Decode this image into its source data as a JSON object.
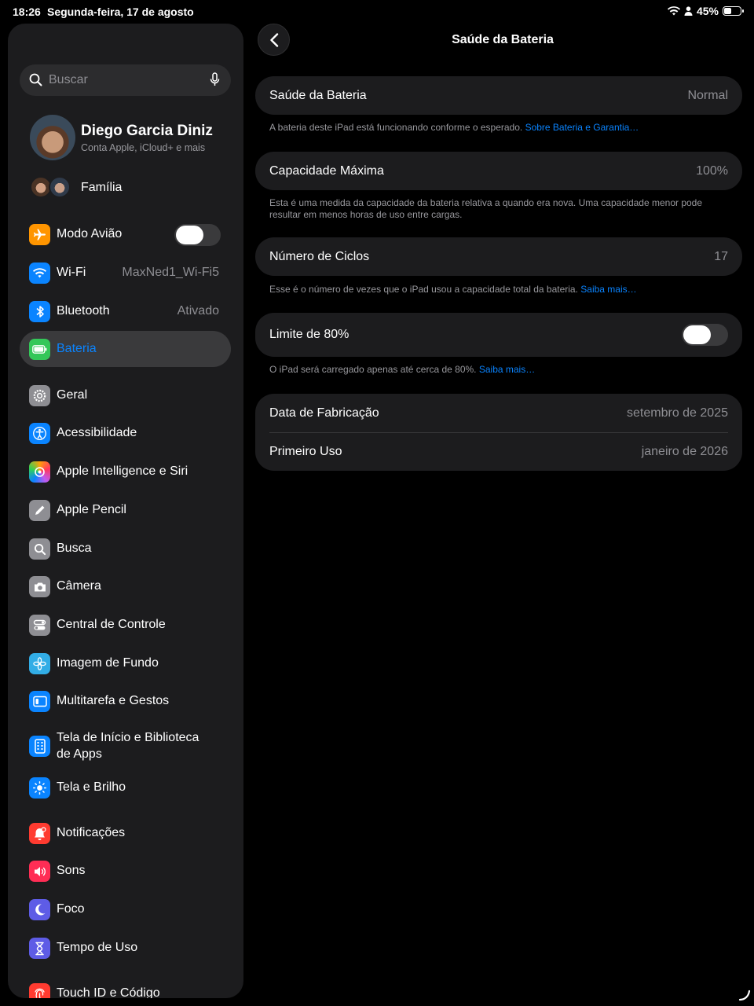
{
  "status_bar": {
    "time": "18:26",
    "date": "Segunda-feira, 17 de agosto",
    "battery_percent": "45%",
    "battery_level": 0.45
  },
  "sidebar": {
    "search_placeholder": "Buscar",
    "profile": {
      "name": "Diego Garcia Diniz",
      "subtitle": "Conta Apple, iCloud+ e mais"
    },
    "family_label": "Família",
    "items": [
      {
        "label": "Modo Avião",
        "icon": "airplane-icon",
        "color": "#ff9500",
        "toggle": false
      },
      {
        "label": "Wi-Fi",
        "icon": "wifi-icon",
        "color": "#0a84ff",
        "value": "MaxNed1_Wi-Fi5"
      },
      {
        "label": "Bluetooth",
        "icon": "bluetooth-icon",
        "color": "#0a84ff",
        "value": "Ativado"
      },
      {
        "label": "Bateria",
        "icon": "battery-icon",
        "color": "#34c759",
        "selected": true
      },
      {
        "label": "Geral",
        "icon": "gear-icon",
        "color": "#8e8e93"
      },
      {
        "label": "Acessibilidade",
        "icon": "accessibility-icon",
        "color": "#0a84ff"
      },
      {
        "label": "Apple Intelligence e Siri",
        "icon": "apple-intelligence-icon",
        "color": "#ff6b9d"
      },
      {
        "label": "Apple Pencil",
        "icon": "pencil-icon",
        "color": "#8e8e93"
      },
      {
        "label": "Busca",
        "icon": "search-icon",
        "color": "#8e8e93"
      },
      {
        "label": "Câmera",
        "icon": "camera-icon",
        "color": "#8e8e93"
      },
      {
        "label": "Central de Controle",
        "icon": "control-center-icon",
        "color": "#8e8e93"
      },
      {
        "label": "Imagem de Fundo",
        "icon": "wallpaper-icon",
        "color": "#32ade6"
      },
      {
        "label": "Multitarefa e Gestos",
        "icon": "multitasking-icon",
        "color": "#0a84ff"
      },
      {
        "label": "Tela de Início e Biblioteca de Apps",
        "icon": "home-screen-icon",
        "color": "#0a84ff"
      },
      {
        "label": "Tela e Brilho",
        "icon": "brightness-icon",
        "color": "#0a84ff"
      },
      {
        "label": "Notificações",
        "icon": "notifications-icon",
        "color": "#ff3b30"
      },
      {
        "label": "Sons",
        "icon": "sounds-icon",
        "color": "#ff2d55"
      },
      {
        "label": "Foco",
        "icon": "focus-moon-icon",
        "color": "#5e5ce6"
      },
      {
        "label": "Tempo de Uso",
        "icon": "hourglass-icon",
        "color": "#5e5ce6"
      },
      {
        "label": "Touch ID e Código",
        "icon": "fingerprint-icon",
        "color": "#ff3b30"
      }
    ]
  },
  "detail": {
    "title": "Saúde da Bateria",
    "battery_health": {
      "label": "Saúde da Bateria",
      "value": "Normal",
      "footnote": "A bateria deste iPad está funcionando conforme o esperado.",
      "link": "Sobre Bateria e Garantia…"
    },
    "max_capacity": {
      "label": "Capacidade Máxima",
      "value": "100%",
      "footnote": "Esta é uma medida da capacidade da bateria relativa a quando era nova. Uma capacidade menor pode resultar em menos horas de uso entre cargas."
    },
    "cycle_count": {
      "label": "Número de Ciclos",
      "value": "17",
      "footnote": "Esse é o número de vezes que o iPad usou a capacidade total da bateria.",
      "link": "Saiba mais…"
    },
    "limit_80": {
      "label": "Limite de 80%",
      "toggle": false,
      "footnote": "O iPad será carregado apenas até cerca de 80%.",
      "link": "Saiba mais…"
    },
    "manufacture": {
      "label": "Data de Fabricação",
      "value": "setembro de 2025"
    },
    "first_use": {
      "label": "Primeiro Uso",
      "value": "janeiro de 2026"
    }
  }
}
